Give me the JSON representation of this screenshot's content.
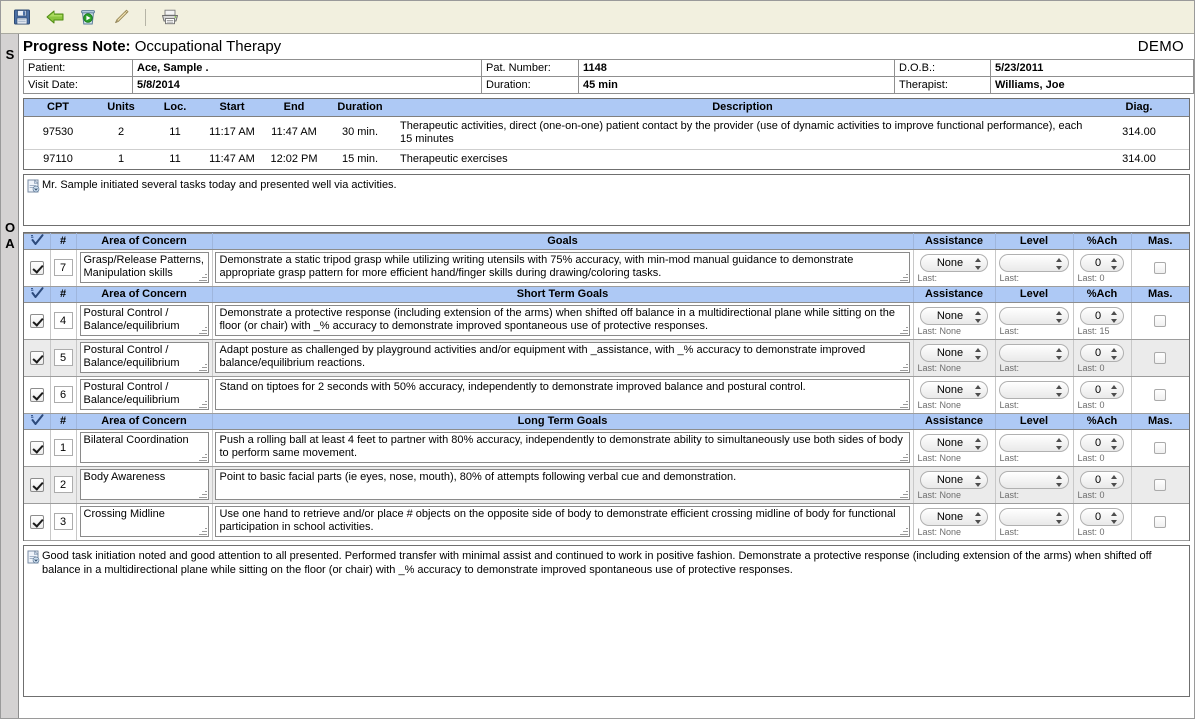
{
  "toolbar": {
    "buttons": [
      {
        "name": "save-icon",
        "label": "Save"
      },
      {
        "name": "back-arrow-icon",
        "label": "Back"
      },
      {
        "name": "recycle-bin-icon",
        "label": "Delete"
      },
      {
        "name": "edit-pencil-icon",
        "label": "Edit"
      },
      {
        "name": "print-icon",
        "label": "Print"
      }
    ]
  },
  "header": {
    "title_bold": "Progress Note:",
    "title_rest": " Occupational Therapy",
    "demo": "DEMO"
  },
  "patient": {
    "rows": [
      [
        {
          "label": "Patient:",
          "value": "Ace, Sample ."
        },
        {
          "label": "Pat. Number:",
          "value": "1148"
        },
        {
          "label": "D.O.B.:",
          "value": "5/23/2011"
        }
      ],
      [
        {
          "label": "Visit Date:",
          "value": "5/8/2014"
        },
        {
          "label": "Duration:",
          "value": "45 min"
        },
        {
          "label": "Therapist:",
          "value": "Williams, Joe"
        }
      ]
    ]
  },
  "cpt": {
    "columns": [
      "CPT",
      "Units",
      "Loc.",
      "Start",
      "End",
      "Duration",
      "Description",
      "Diag."
    ],
    "rows": [
      {
        "cpt": "97530",
        "units": "2",
        "loc": "11",
        "start": "11:17 AM",
        "end": "11:47 AM",
        "duration": "30 min.",
        "description": "Therapeutic activities, direct (one-on-one) patient contact by the provider (use of dynamic activities to improve functional performance), each 15 minutes",
        "diag": "314.00"
      },
      {
        "cpt": "97110",
        "units": "1",
        "loc": "11",
        "start": "11:47 AM",
        "end": "12:02 PM",
        "duration": "15 min.",
        "description": "Therapeutic exercises",
        "diag": "314.00"
      }
    ]
  },
  "subjective_note": {
    "icon": "note-document-icon",
    "text": "Mr. Sample initiated several tasks today and presented well via activities."
  },
  "goal_columns": {
    "check": "check-icon",
    "number": "#",
    "area": "Area of Concern",
    "assistance": "Assistance",
    "level": "Level",
    "ach": "%Ach",
    "mas": "Mas."
  },
  "goal_sections": [
    {
      "goals_header": "Goals",
      "rows": [
        {
          "checked": true,
          "num": "7",
          "area": "Grasp/Release Patterns, Manipulation skills",
          "goal": "Demonstrate a static tripod grasp while utilizing writing utensils with 75% accuracy, with min-mod manual guidance to demonstrate appropriate grasp pattern for more efficient hand/finger skills during drawing/coloring tasks.",
          "assistance": "None",
          "assistance_last": "Last:",
          "level": "",
          "level_last": "Last:",
          "ach": "0",
          "ach_last": "Last: 0",
          "mastered": false,
          "alt": false
        }
      ]
    },
    {
      "goals_header": "Short Term Goals",
      "rows": [
        {
          "checked": true,
          "num": "4",
          "area": "Postural Control / Balance/equilibrium",
          "goal": "Demonstrate a protective response (including extension of the arms) when shifted off balance in a multidirectional plane while sitting on the floor (or chair) with _% accuracy to demonstrate improved spontaneous use of protective responses.",
          "assistance": "None",
          "assistance_last": "Last: None",
          "level": "",
          "level_last": "Last:",
          "ach": "0",
          "ach_last": "Last: 15",
          "mastered": false,
          "alt": false
        },
        {
          "checked": true,
          "num": "5",
          "area": "Postural Control / Balance/equilibrium",
          "goal": "Adapt posture as challenged by playground activities and/or equipment with _assistance, with _% accuracy to demonstrate improved balance/equilibrium reactions.",
          "assistance": "None",
          "assistance_last": "Last: None",
          "level": "",
          "level_last": "Last:",
          "ach": "0",
          "ach_last": "Last: 0",
          "mastered": false,
          "alt": true
        },
        {
          "checked": true,
          "num": "6",
          "area": "Postural Control / Balance/equilibrium",
          "goal": "Stand on tiptoes for 2 seconds with 50% accuracy, independently to demonstrate improved balance and postural control.",
          "assistance": "None",
          "assistance_last": "Last: None",
          "level": "",
          "level_last": "Last:",
          "ach": "0",
          "ach_last": "Last: 0",
          "mastered": false,
          "alt": false
        }
      ]
    },
    {
      "goals_header": "Long Term Goals",
      "rows": [
        {
          "checked": true,
          "num": "1",
          "area": "Bilateral Coordination",
          "goal": "Push a rolling ball at least 4 feet to partner with 80% accuracy, independently to demonstrate ability to simultaneously use both sides of body to perform same movement.",
          "assistance": "None",
          "assistance_last": "Last: None",
          "level": "",
          "level_last": "Last:",
          "ach": "0",
          "ach_last": "Last: 0",
          "mastered": false,
          "alt": false
        },
        {
          "checked": true,
          "num": "2",
          "area": "Body Awareness",
          "goal": "Point to basic facial parts (ie eyes, nose, mouth), 80% of attempts following verbal cue and demonstration.",
          "assistance": "None",
          "assistance_last": "Last: None",
          "level": "",
          "level_last": "Last:",
          "ach": "0",
          "ach_last": "Last: 0",
          "mastered": false,
          "alt": true
        },
        {
          "checked": true,
          "num": "3",
          "area": "Crossing Midline",
          "goal": "Use one hand to retrieve and/or place # objects on the opposite side of body to demonstrate efficient crossing midline of body for functional participation in school activities.",
          "assistance": "None",
          "assistance_last": "Last: None",
          "level": "",
          "level_last": "Last:",
          "ach": "0",
          "ach_last": "Last: 0",
          "mastered": false,
          "alt": false
        }
      ]
    }
  ],
  "assessment_note": {
    "icon": "note-document-icon",
    "text": "Good task initiation noted and good attention to all presented.  Performed transfer with minimal assist and continued to work in positive fashion.  Demonstrate a protective response (including extension of the arms) when shifted off balance in a multidirectional plane while sitting on the floor (or chair) with _% accuracy to demonstrate improved spontaneous use of protective responses."
  },
  "gutter": {
    "s": "S",
    "o": "O",
    "a": "A"
  },
  "colors": {
    "header_blue": "#aec9f5",
    "toolbar_bg": "#f2f0df",
    "gutter_bg": "#d4d2d2",
    "alt_row": "#ebebeb"
  }
}
